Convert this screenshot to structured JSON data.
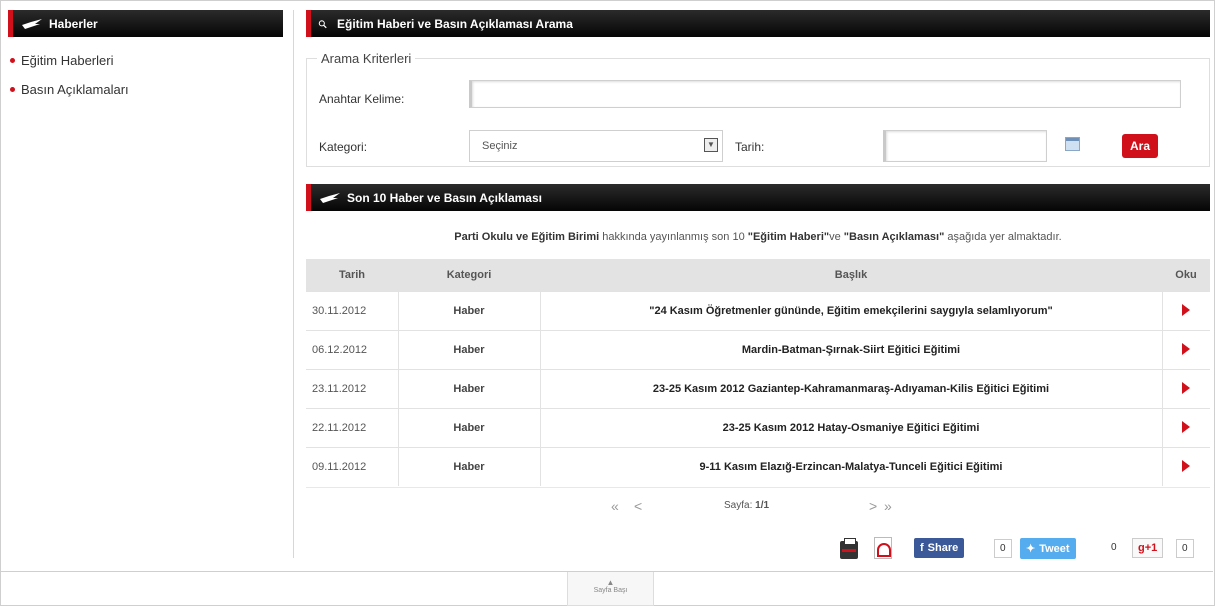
{
  "sidebar": {
    "header": "Haberler",
    "items": [
      {
        "label": "Eğitim Haberleri"
      },
      {
        "label": "Basın Açıklamaları"
      }
    ]
  },
  "search": {
    "header": "Eğitim Haberi ve Basın Açıklaması Arama",
    "legend": "Arama Kriterleri",
    "keyword_label": "Anahtar Kelime:",
    "keyword_value": "",
    "category_label": "Kategori:",
    "category_selected": "Seçiniz",
    "date_label": "Tarih:",
    "date_value": "",
    "search_button": "Ara"
  },
  "news": {
    "header": "Son 10 Haber ve Basın Açıklaması",
    "intro_bold1": "Parti Okulu ve Eğitim Birimi",
    "intro_text1": " hakkında yayınlanmış son 10 ",
    "intro_bold2": "\"Eğitim Haberi\"",
    "intro_text2": "ve ",
    "intro_bold3": "\"Basın Açıklaması\"",
    "intro_text3": " aşağıda yer almaktadır.",
    "columns": [
      "Tarih",
      "Kategori",
      "Başlık",
      "Oku"
    ],
    "rows": [
      {
        "date": "30.11.2012",
        "category": "Haber",
        "title": "\"24 Kasım Öğretmenler gününde, Eğitim emekçilerini saygıyla selamlıyorum\""
      },
      {
        "date": "06.12.2012",
        "category": "Haber",
        "title": "Mardin-Batman-Şırnak-Siirt Eğitici Eğitimi"
      },
      {
        "date": "23.11.2012",
        "category": "Haber",
        "title": "23-25 Kasım 2012 Gaziantep-Kahramanmaraş-Adıyaman-Kilis Eğitici Eğitimi"
      },
      {
        "date": "22.11.2012",
        "category": "Haber",
        "title": "23-25 Kasım 2012 Hatay-Osmaniye Eğitici Eğitimi"
      },
      {
        "date": "09.11.2012",
        "category": "Haber",
        "title": "9-11 Kasım Elazığ-Erzincan-Malatya-Tunceli Eğitici Eğitimi"
      }
    ],
    "pager": {
      "first": "«",
      "prev": "<",
      "label": "Sayfa:",
      "value": "1/1",
      "next": ">",
      "last": "»"
    }
  },
  "social": {
    "fb_label": "Share",
    "fb_count": "0",
    "tw_label": "Tweet",
    "tw_count": "0",
    "gp_label": "+1",
    "gp_count": "0"
  },
  "footer": {
    "top_button": "Sayfa Başı"
  },
  "colors": {
    "accent": "#d0101b",
    "header_bg": "#111111"
  }
}
